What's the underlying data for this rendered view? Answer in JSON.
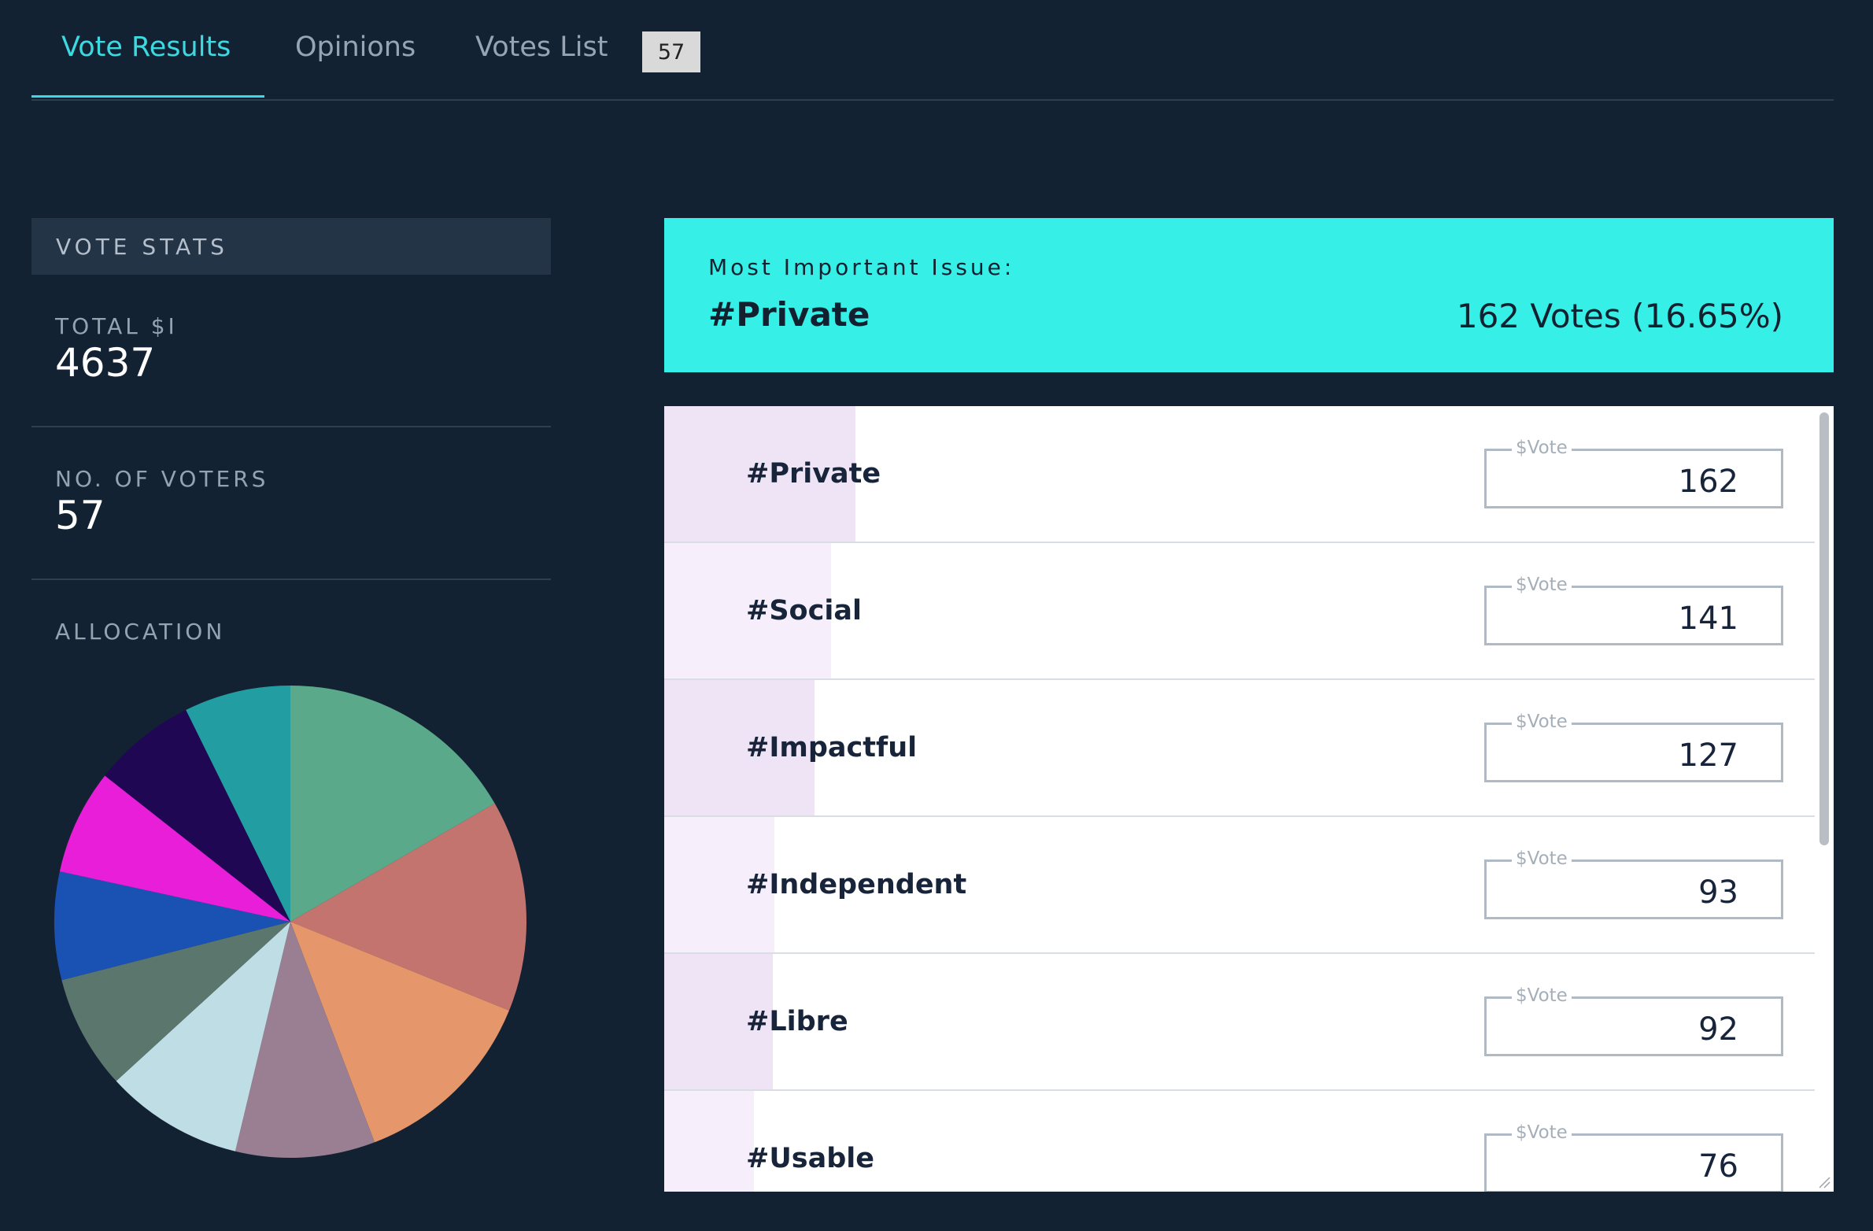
{
  "tabs": [
    {
      "label": "Vote Results",
      "active": true
    },
    {
      "label": "Opinions",
      "active": false
    },
    {
      "label": "Votes List",
      "active": false,
      "badge": "57"
    }
  ],
  "stats": {
    "header": "VOTE STATS",
    "total_label": "TOTAL $I",
    "total_value": "4637",
    "voters_label": "NO. OF VOTERS",
    "voters_value": "57",
    "allocation_label": "ALLOCATION"
  },
  "banner": {
    "label": "Most Important Issue:",
    "issue": "#Private",
    "votes": "162 Votes (16.65%)"
  },
  "vote_field_legend": "$Vote",
  "issues": [
    {
      "label": "#Private",
      "value": "162",
      "share": 0.1665,
      "fill": "#efe4f6"
    },
    {
      "label": "#Social",
      "value": "141",
      "share": 0.145,
      "fill": "#f6effb"
    },
    {
      "label": "#Impactful",
      "value": "127",
      "share": 0.1305,
      "fill": "#efe4f6"
    },
    {
      "label": "#Independent",
      "value": "93",
      "share": 0.0956,
      "fill": "#f6effb"
    },
    {
      "label": "#Libre",
      "value": "92",
      "share": 0.0946,
      "fill": "#efe4f6"
    },
    {
      "label": "#Usable",
      "value": "76",
      "share": 0.0781,
      "fill": "#f6effb"
    }
  ],
  "chart_data": {
    "type": "pie",
    "slices": [
      {
        "value": 162,
        "color": "#5aa98a"
      },
      {
        "value": 141,
        "color": "#c4746e"
      },
      {
        "value": 127,
        "color": "#e5966a"
      },
      {
        "value": 93,
        "color": "#9a7f92"
      },
      {
        "value": 92,
        "color": "#bfdde4"
      },
      {
        "value": 76,
        "color": "#5b766c"
      },
      {
        "value": 72,
        "color": "#1a52b4"
      },
      {
        "value": 70,
        "color": "#e91ed8"
      },
      {
        "value": 69,
        "color": "#1f0754"
      },
      {
        "value": 71,
        "color": "#229ea3"
      }
    ]
  }
}
